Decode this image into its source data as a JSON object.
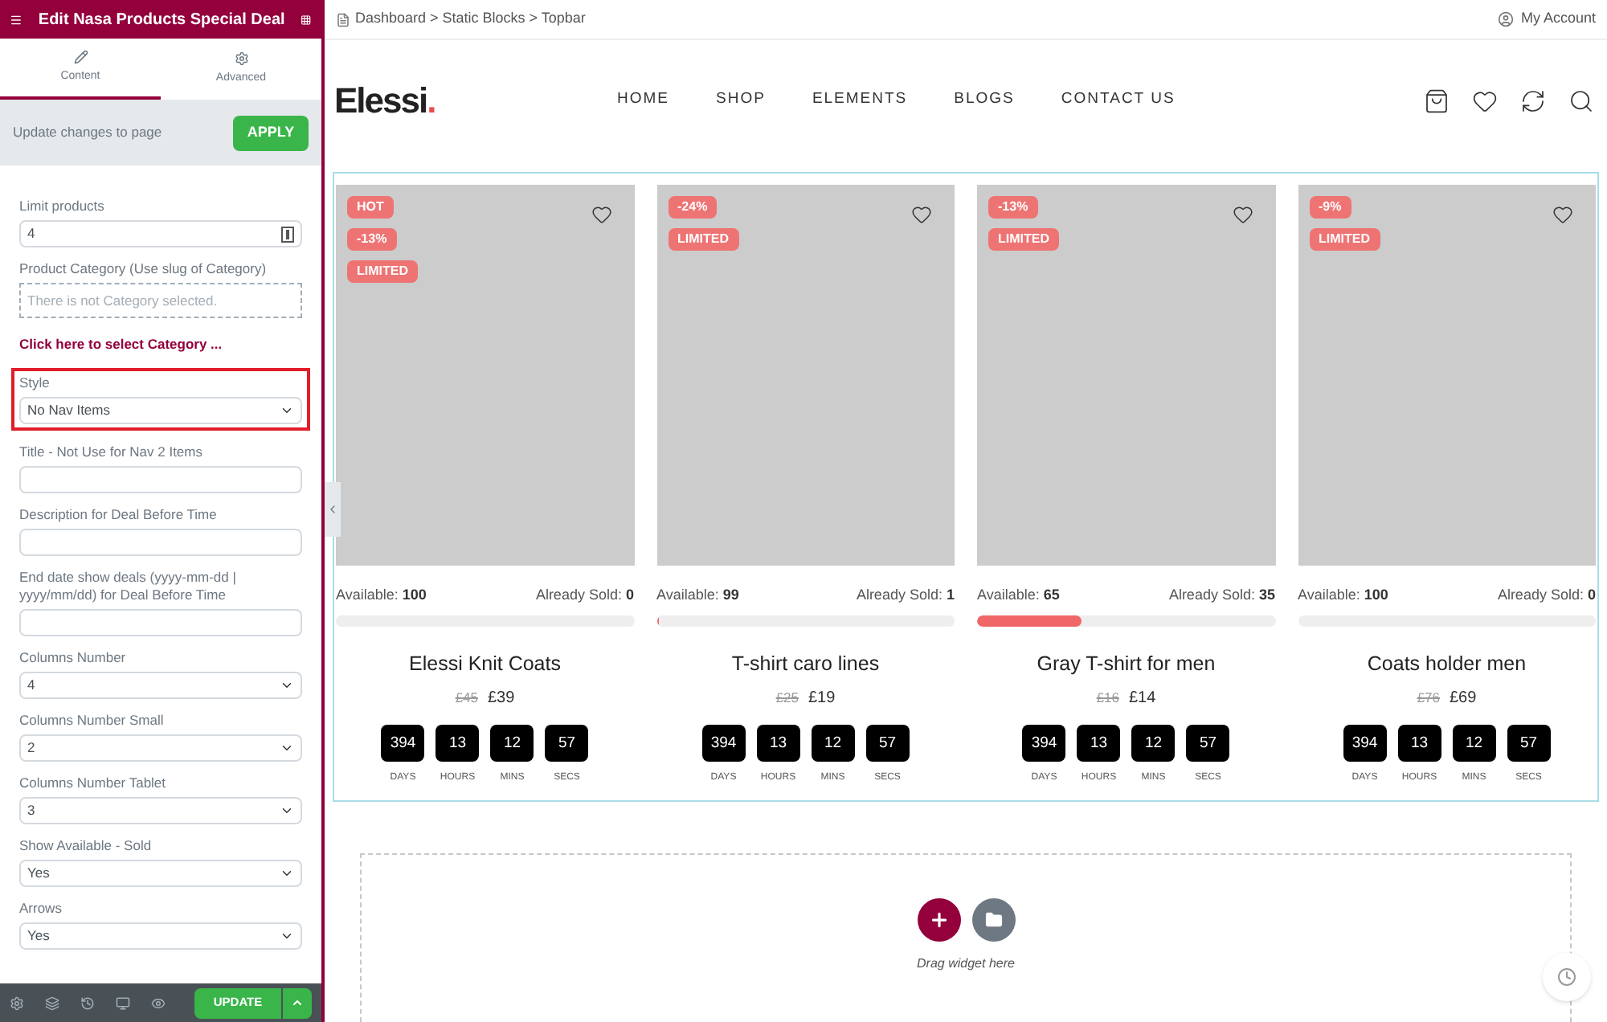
{
  "panel": {
    "title": "Edit Nasa Products Special Deal",
    "tabs": [
      {
        "label": "Content",
        "selected": true
      },
      {
        "label": "Advanced",
        "selected": false
      }
    ],
    "apply_note": "Update changes to page",
    "apply_button": "APPLY",
    "fields": [
      {
        "kind": "number",
        "label": "Limit products",
        "value": "4",
        "highlighted": false
      },
      {
        "kind": "category",
        "label": "Product Category (Use slug of Category)",
        "placeholder": "There is not Category selected.",
        "link": "Click here to select Category ...",
        "highlighted": false
      },
      {
        "kind": "select",
        "label": "Style",
        "value": "No Nav Items",
        "highlighted": true
      },
      {
        "kind": "text",
        "label": "Title - Not Use for Nav 2 Items",
        "highlighted": false
      },
      {
        "kind": "text",
        "label": "Description for Deal Before Time",
        "highlighted": false
      },
      {
        "kind": "text",
        "label": "End date show deals (yyyy-mm-dd | yyyy/mm/dd) for Deal Before Time",
        "highlighted": false
      },
      {
        "kind": "select",
        "label": "Columns Number",
        "value": "4",
        "highlighted": false
      },
      {
        "kind": "select",
        "label": "Columns Number Small",
        "value": "2",
        "highlighted": false
      },
      {
        "kind": "select",
        "label": "Columns Number Tablet",
        "value": "3",
        "highlighted": false
      },
      {
        "kind": "select",
        "label": "Show Available - Sold",
        "value": "Yes",
        "highlighted": false
      },
      {
        "kind": "select",
        "label": "Arrows",
        "value": "Yes",
        "highlighted": false
      }
    ],
    "update_button": "UPDATE"
  },
  "breadcrumb": "Dashboard > Static Blocks > Topbar",
  "account": "My Account",
  "logo": {
    "text": "Elessi",
    "dot": "."
  },
  "nav": [
    "HOME",
    "SHOP",
    "ELEMENTS",
    "BLOGS",
    "CONTACT US"
  ],
  "products": [
    {
      "badges": [
        "HOT",
        "-13%",
        "LIMITED"
      ],
      "available_label": "Available:",
      "available": "100",
      "sold_label": "Already Sold:",
      "sold": "0",
      "level": 0,
      "name": "Elessi Knit Coats",
      "old_price": "£45",
      "price": "£39",
      "countdown": [
        {
          "value": "394",
          "unit": "DAYS"
        },
        {
          "value": "13",
          "unit": "HOURS"
        },
        {
          "value": "12",
          "unit": "MINS"
        },
        {
          "value": "57",
          "unit": "SECS"
        }
      ]
    },
    {
      "badges": [
        "-24%",
        "LIMITED"
      ],
      "available_label": "Available:",
      "available": "99",
      "sold_label": "Already Sold:",
      "sold": "1",
      "level": 0.01,
      "name": "T-shirt caro lines",
      "old_price": "£25",
      "price": "£19",
      "countdown": [
        {
          "value": "394",
          "unit": "DAYS"
        },
        {
          "value": "13",
          "unit": "HOURS"
        },
        {
          "value": "12",
          "unit": "MINS"
        },
        {
          "value": "57",
          "unit": "SECS"
        }
      ]
    },
    {
      "badges": [
        "-13%",
        "LIMITED"
      ],
      "available_label": "Available:",
      "available": "65",
      "sold_label": "Already Sold:",
      "sold": "35",
      "level": 0.35,
      "name": "Gray T-shirt for men",
      "old_price": "£16",
      "price": "£14",
      "countdown": [
        {
          "value": "394",
          "unit": "DAYS"
        },
        {
          "value": "13",
          "unit": "HOURS"
        },
        {
          "value": "12",
          "unit": "MINS"
        },
        {
          "value": "57",
          "unit": "SECS"
        }
      ]
    },
    {
      "badges": [
        "-9%",
        "LIMITED"
      ],
      "available_label": "Available:",
      "available": "100",
      "sold_label": "Already Sold:",
      "sold": "0",
      "level": 0,
      "name": "Coats holder men",
      "old_price": "£76",
      "price": "£69",
      "countdown": [
        {
          "value": "394",
          "unit": "DAYS"
        },
        {
          "value": "13",
          "unit": "HOURS"
        },
        {
          "value": "12",
          "unit": "MINS"
        },
        {
          "value": "57",
          "unit": "SECS"
        }
      ]
    }
  ],
  "drop_zone": {
    "hint": "Drag widget here"
  }
}
